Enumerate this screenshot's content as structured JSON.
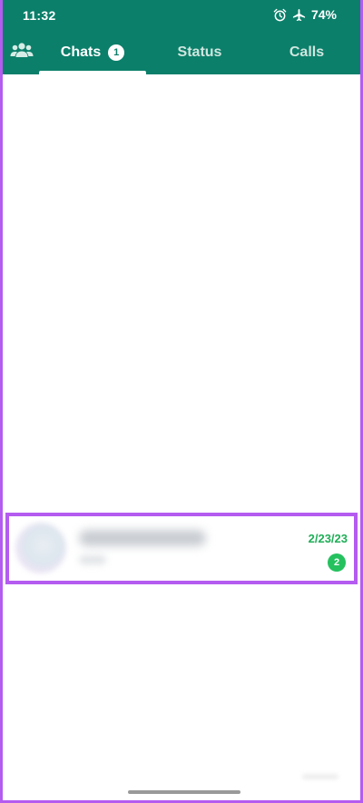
{
  "status_bar": {
    "time": "11:32",
    "battery": "74%",
    "icons": [
      "alarm-icon",
      "airplane-icon"
    ]
  },
  "tabs": {
    "community_icon": "community-icon",
    "items": [
      {
        "label": "Chats",
        "badge": "1",
        "active": true
      },
      {
        "label": "Status",
        "active": false
      },
      {
        "label": "Calls",
        "active": false
      }
    ]
  },
  "chat": {
    "date": "2/23/23",
    "unread_count": "2"
  },
  "colors": {
    "header": "#0b7f6a",
    "accent_green": "#25c15f",
    "highlight": "#b45bf0"
  }
}
